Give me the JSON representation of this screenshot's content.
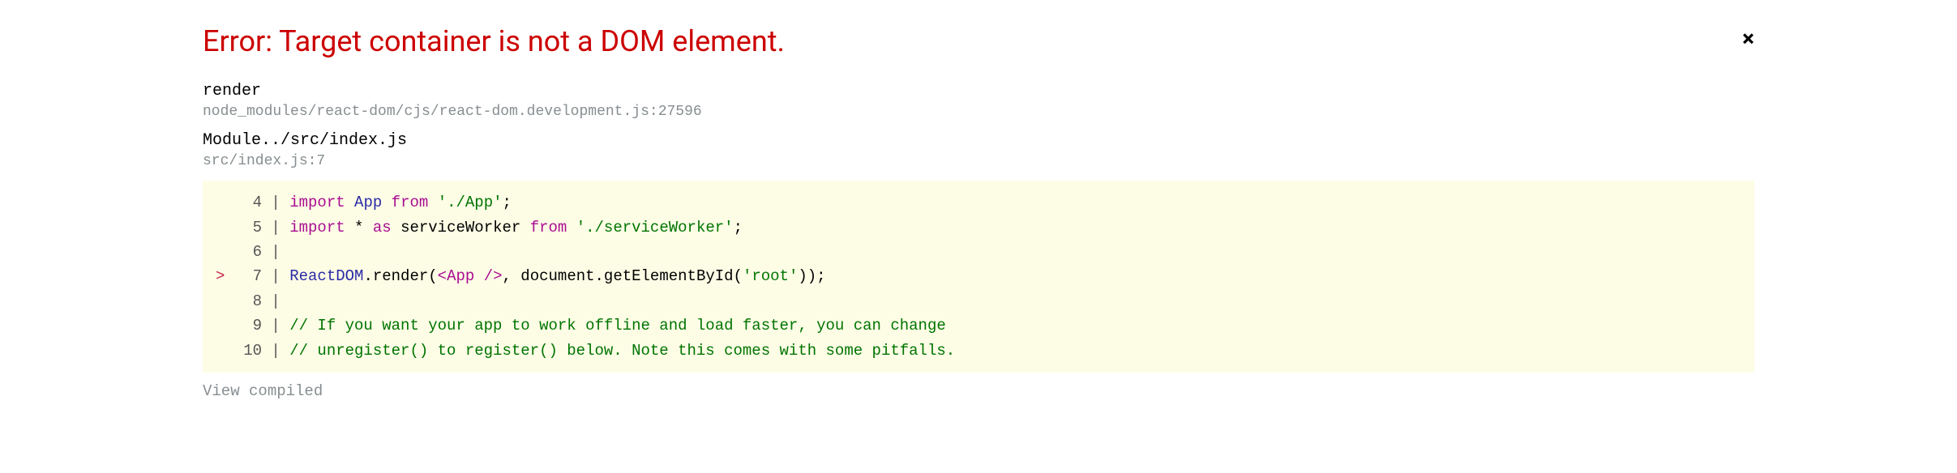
{
  "header": {
    "title": "Error: Target container is not a DOM element.",
    "close_label": "×"
  },
  "frames": [
    {
      "fn": "render",
      "loc": "node_modules/react-dom/cjs/react-dom.development.js:27596"
    },
    {
      "fn": "Module../src/index.js",
      "loc": "src/index.js:7"
    }
  ],
  "codeframe": {
    "lines": [
      {
        "num": "4",
        "cursor": " ",
        "content_tokens": [
          {
            "t": "kw",
            "v": "import"
          },
          {
            "t": "plain",
            "v": " "
          },
          {
            "t": "id",
            "v": "App"
          },
          {
            "t": "plain",
            "v": " "
          },
          {
            "t": "kw",
            "v": "from"
          },
          {
            "t": "plain",
            "v": " "
          },
          {
            "t": "str",
            "v": "'./App'"
          },
          {
            "t": "plain",
            "v": ";"
          }
        ]
      },
      {
        "num": "5",
        "cursor": " ",
        "content_tokens": [
          {
            "t": "kw",
            "v": "import"
          },
          {
            "t": "plain",
            "v": " * "
          },
          {
            "t": "kw",
            "v": "as"
          },
          {
            "t": "plain",
            "v": " serviceWorker "
          },
          {
            "t": "kw",
            "v": "from"
          },
          {
            "t": "plain",
            "v": " "
          },
          {
            "t": "str",
            "v": "'./serviceWorker'"
          },
          {
            "t": "plain",
            "v": ";"
          }
        ]
      },
      {
        "num": "6",
        "cursor": " ",
        "content_tokens": []
      },
      {
        "num": "7",
        "cursor": ">",
        "content_tokens": [
          {
            "t": "id",
            "v": "ReactDOM"
          },
          {
            "t": "plain",
            "v": ".render("
          },
          {
            "t": "tag",
            "v": "<"
          },
          {
            "t": "tag",
            "v": "App"
          },
          {
            "t": "plain",
            "v": " "
          },
          {
            "t": "tag",
            "v": "/>"
          },
          {
            "t": "plain",
            "v": ", document.getElementById("
          },
          {
            "t": "str",
            "v": "'root'"
          },
          {
            "t": "plain",
            "v": "));"
          }
        ]
      },
      {
        "num": "8",
        "cursor": " ",
        "content_tokens": []
      },
      {
        "num": "9",
        "cursor": " ",
        "content_tokens": [
          {
            "t": "comment",
            "v": "// If you want your app to work offline and load faster, you can change"
          }
        ]
      },
      {
        "num": "10",
        "cursor": " ",
        "content_tokens": [
          {
            "t": "comment",
            "v": "// unregister() to register() below. Note this comes with some pitfalls."
          }
        ]
      }
    ]
  },
  "footer": {
    "view_compiled": "View compiled"
  }
}
